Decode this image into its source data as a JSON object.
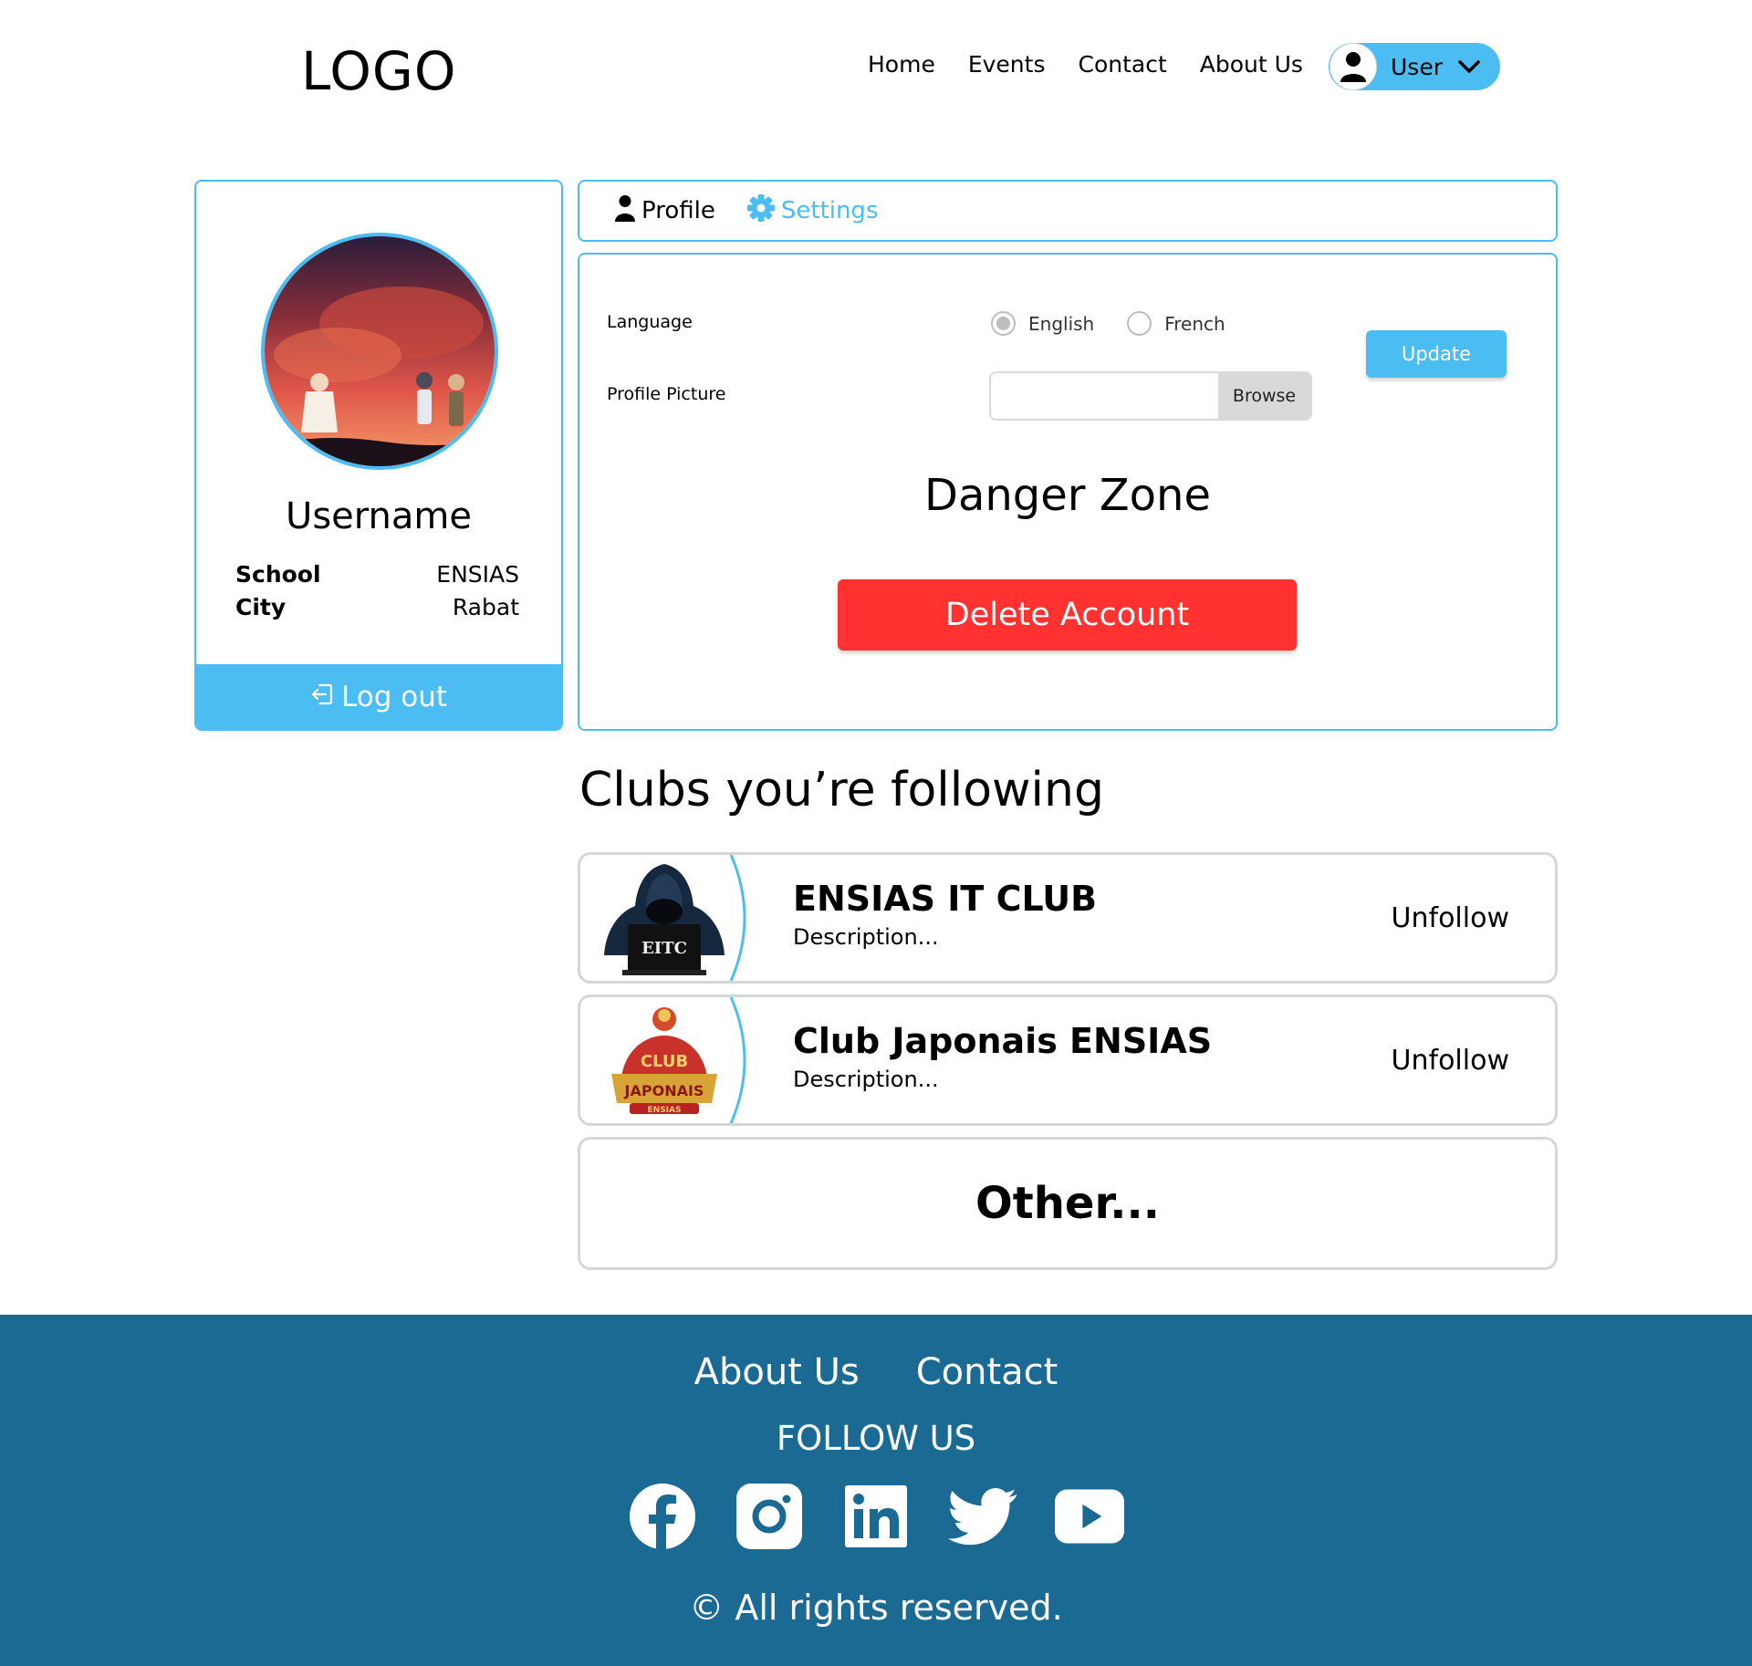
{
  "header": {
    "logo": "LOGO",
    "nav": [
      "Home",
      "Events",
      "Contact",
      "About Us"
    ],
    "user_label": "User"
  },
  "profile": {
    "username": "Username",
    "info": [
      {
        "key": "School",
        "value": "ENSIAS"
      },
      {
        "key": "City",
        "value": "Rabat"
      }
    ],
    "logout_label": "Log out"
  },
  "tabs": {
    "profile": "Profile",
    "settings": "Settings",
    "active": "Settings"
  },
  "settings": {
    "language_label": "Language",
    "languages": [
      {
        "label": "English",
        "selected": true
      },
      {
        "label": "French",
        "selected": false
      }
    ],
    "picture_label": "Profile Picture",
    "picture_value": "",
    "browse_label": "Browse",
    "update_label": "Update",
    "danger_title": "Danger Zone",
    "delete_label": "Delete Account"
  },
  "clubs": {
    "title": "Clubs you’re following",
    "items": [
      {
        "name": "ENSIAS IT CLUB",
        "description": "Description...",
        "action": "Unfollow",
        "logo_icon": "hooded-hacker-laptop-icon"
      },
      {
        "name": "Club Japonais ENSIAS",
        "description": "Description...",
        "action": "Unfollow",
        "logo_icon": "club-japonais-emblem-icon"
      }
    ],
    "other_label": "Other..."
  },
  "footer": {
    "links": [
      "About Us",
      "Contact"
    ],
    "follow_label": "FOLLOW US",
    "socials": [
      "facebook-icon",
      "instagram-icon",
      "linkedin-icon",
      "twitter-icon",
      "youtube-icon"
    ],
    "copyright": "© All rights reserved."
  },
  "colors": {
    "accent": "#4cbdf2",
    "danger": "#ff3131",
    "footer": "#1b6a94"
  }
}
